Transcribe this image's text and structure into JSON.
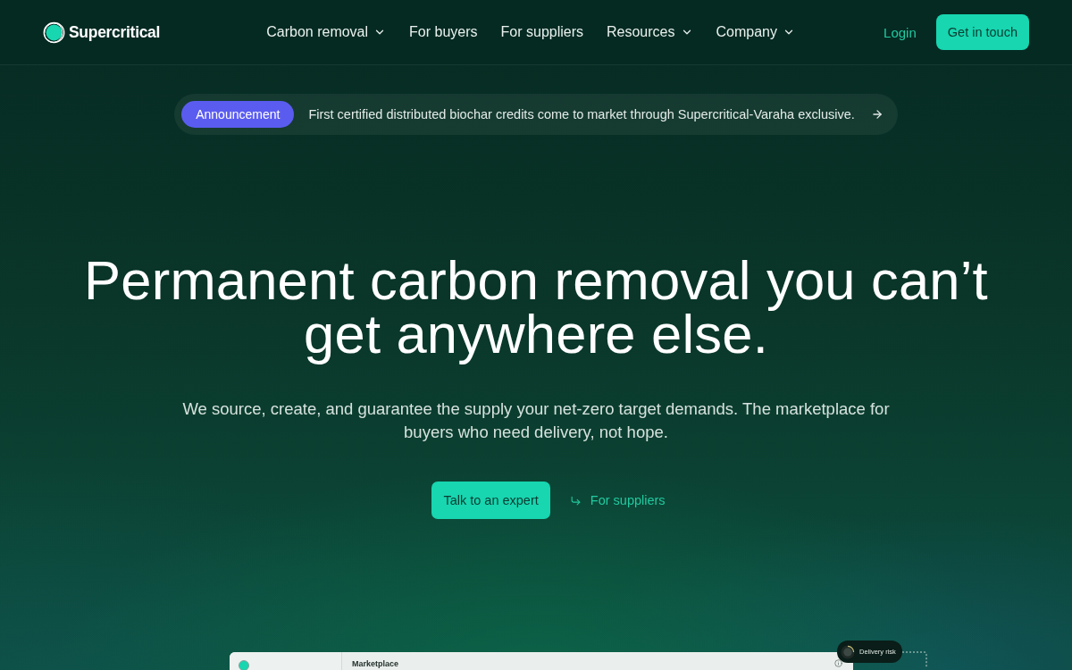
{
  "header": {
    "logo": {
      "text": "Supercritical"
    },
    "nav": [
      {
        "label": "Carbon removal",
        "dropdown": true
      },
      {
        "label": "For buyers",
        "dropdown": false
      },
      {
        "label": "For suppliers",
        "dropdown": false
      },
      {
        "label": "Resources",
        "dropdown": true
      },
      {
        "label": "Company",
        "dropdown": true
      }
    ],
    "login": "Login",
    "cta": "Get in touch"
  },
  "announcement": {
    "badge": "Announcement",
    "text": "First certified distributed biochar credits come to market through Supercritical-Varaha exclusive."
  },
  "hero": {
    "title": "Permanent carbon removal you can’t get anywhere else.",
    "subtitle": "We source, create, and guarantee the supply your net-zero target demands. The marketplace for buyers who need delivery, not hope.",
    "primary_button": "Talk to an expert",
    "secondary_link": "For suppliers"
  },
  "preview": {
    "title": "Marketplace",
    "floating_tag": "Delivery risk"
  }
}
